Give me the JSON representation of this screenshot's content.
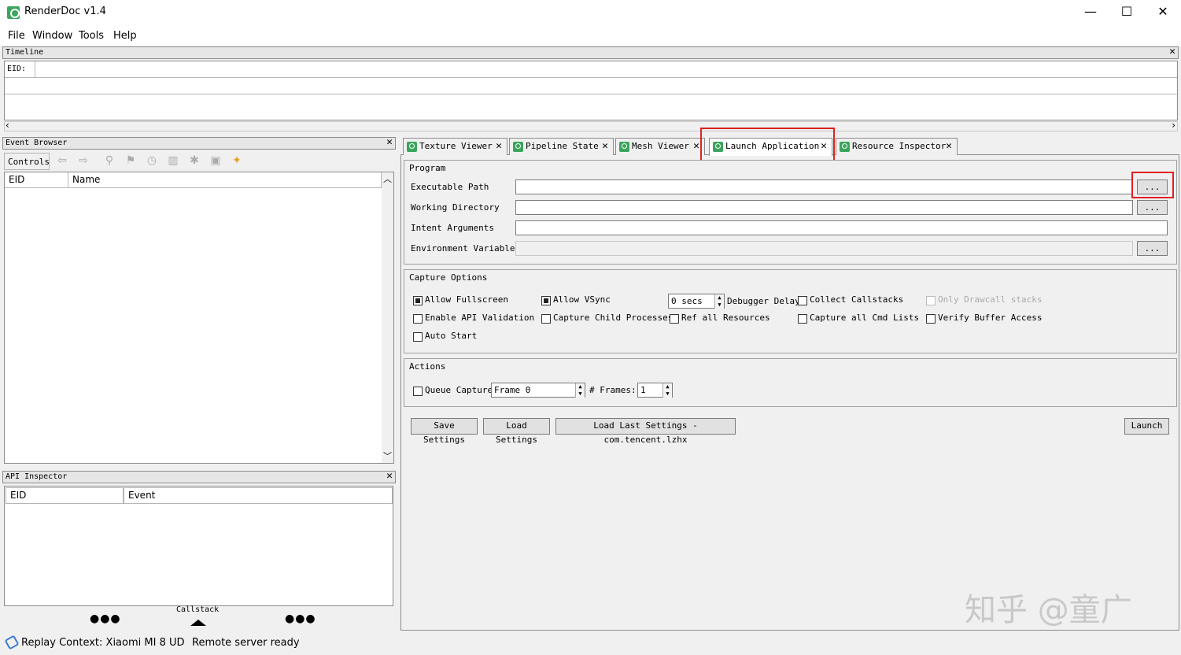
{
  "window": {
    "title": "RenderDoc v1.4",
    "controls": [
      "—",
      "☐",
      "✕"
    ]
  },
  "menu": [
    "File",
    "Window",
    "Tools",
    "Help"
  ],
  "timeline": {
    "title": "Timeline",
    "eid_label": "EID:"
  },
  "event_browser": {
    "title": "Event Browser",
    "controls_label": "Controls",
    "columns": [
      "EID",
      "Name"
    ]
  },
  "api_inspector": {
    "title": "API Inspector",
    "columns": [
      "EID",
      "Event"
    ],
    "callstack_label": "Callstack"
  },
  "tabs": [
    {
      "label": "Texture Viewer"
    },
    {
      "label": "Pipeline State"
    },
    {
      "label": "Mesh Viewer"
    },
    {
      "label": "Launch Application"
    },
    {
      "label": "Resource Inspector"
    }
  ],
  "program": {
    "title": "Program",
    "executable_path_label": "Executable Path",
    "working_directory_label": "Working Directory",
    "intent_arguments_label": "Intent Arguments",
    "environment_variables_label": "Environment Variables",
    "browse_label": "..."
  },
  "capture_options": {
    "title": "Capture Options",
    "allow_fullscreen": "Allow Fullscreen",
    "allow_vsync": "Allow VSync",
    "debugger_delay_value": "0 secs",
    "debugger_delay_label": "Debugger Delay",
    "collect_callstacks": "Collect Callstacks",
    "only_drawcall_stacks": "Only Drawcall stacks",
    "enable_api_validation": "Enable API Validation",
    "capture_child_processes": "Capture Child Processes",
    "ref_all_resources": "Ref all Resources",
    "capture_all_cmd_lists": "Capture all Cmd Lists",
    "verify_buffer_access": "Verify Buffer Access",
    "auto_start": "Auto Start"
  },
  "actions": {
    "title": "Actions",
    "queue_capture": "Queue Capture",
    "frame_value": "Frame 0",
    "frames_label": "# Frames:",
    "frames_value": "1"
  },
  "buttons": {
    "save_settings": "Save Settings",
    "load_settings": "Load Settings",
    "load_last_settings": "Load Last Settings - com.tencent.lzhx",
    "launch": "Launch"
  },
  "status": {
    "replay_context": "Replay Context: Xiaomi MI 8 UD",
    "server": "Remote server ready"
  },
  "watermark": "知乎 @童广"
}
